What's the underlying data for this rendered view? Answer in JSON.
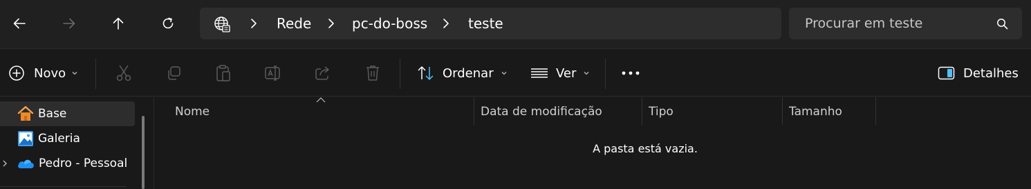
{
  "navigation": {
    "back_icon": "arrow-left-icon",
    "forward_icon": "arrow-right-icon",
    "up_icon": "arrow-up-icon",
    "refresh_icon": "refresh-icon"
  },
  "address": {
    "root_icon": "network-globe-icon",
    "breadcrumbs": [
      "Rede",
      "pc-do-boss",
      "teste"
    ]
  },
  "search": {
    "placeholder": "Procurar em teste"
  },
  "toolbar": {
    "new_label": "Novo",
    "sort_label": "Ordenar",
    "view_label": "Ver",
    "details_label": "Detalhes",
    "icons": [
      "cut-icon",
      "copy-icon",
      "paste-icon",
      "rename-icon",
      "share-icon",
      "delete-icon",
      "more-icon"
    ]
  },
  "sidebar": {
    "items": [
      {
        "label": "Base",
        "icon": "home-icon",
        "selected": true
      },
      {
        "label": "Galeria",
        "icon": "gallery-icon"
      },
      {
        "label": "Pedro - Pessoal",
        "icon": "onedrive-cloud-icon",
        "expandable": true
      }
    ]
  },
  "columns": [
    "Nome",
    "Data de modificação",
    "Tipo",
    "Tamanho"
  ],
  "empty_message": "A pasta está vazia.",
  "colors": {
    "background": "#191919",
    "titlebar": "#202020",
    "input_bg": "#2d2d2d",
    "selected": "#2d2d2d",
    "accent_blue": "#4cc2ff",
    "disabled_icon": "#5c5c5c"
  }
}
